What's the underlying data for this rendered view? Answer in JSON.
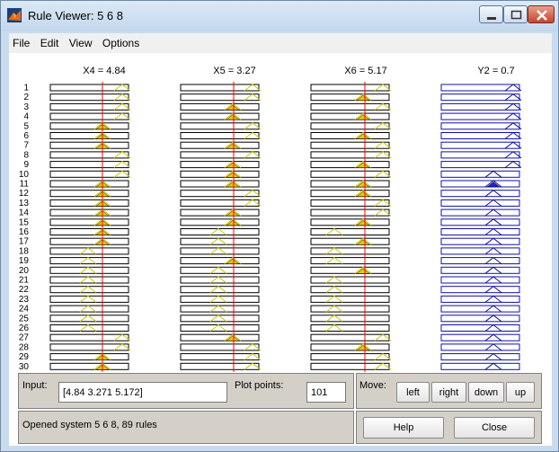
{
  "window": {
    "title": "Rule Viewer: 5 6 8"
  },
  "menu": [
    "File",
    "Edit",
    "View",
    "Options"
  ],
  "columns": [
    {
      "header": "X4 = 4.84",
      "value_line_ratio": 0.42
    },
    {
      "header": "X5 = 3.27",
      "value_line_ratio": 0.42
    },
    {
      "header": "X6 = 5.17",
      "value_line_ratio": 0.42
    },
    {
      "header": "Y2 = 0.7"
    }
  ],
  "rule_numbers": [
    "1",
    "2",
    "3",
    "4",
    "5",
    "6",
    "7",
    "8",
    "9",
    "10",
    "11",
    "12",
    "13",
    "14",
    "15",
    "16",
    "17",
    "18",
    "19",
    "20",
    "21",
    "22",
    "23",
    "24",
    "25",
    "26",
    "27",
    "28",
    "29",
    "30"
  ],
  "input": {
    "label": "Input:",
    "value": "[4.84 3.271 5.172]"
  },
  "plot_points": {
    "label": "Plot points:",
    "value": "101"
  },
  "move": {
    "label": "Move:",
    "left": "left",
    "right": "right",
    "down": "down",
    "up": "up"
  },
  "status": "Opened system 5 6 8, 89 rules",
  "buttons": {
    "help": "Help",
    "close": "Close"
  },
  "colors": {
    "input_fill": "#f5c400",
    "output_fill": "#2020d0",
    "value_line": "#ff0000",
    "output_stroke": "#1010a0"
  }
}
